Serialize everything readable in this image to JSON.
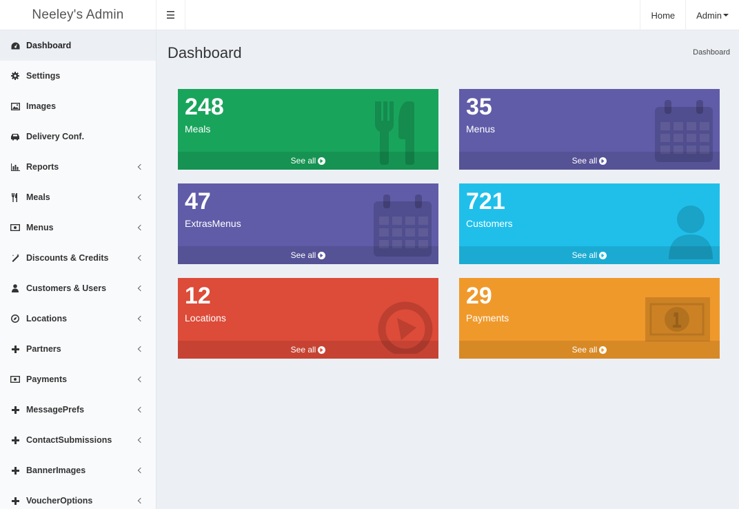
{
  "brand": "Neeley's Admin",
  "topnav": {
    "home": "Home",
    "admin": "Admin"
  },
  "sidebar": {
    "items": [
      {
        "label": "Dashboard",
        "icon": "dashboard-icon",
        "active": true
      },
      {
        "label": "Settings",
        "icon": "gear-icon"
      },
      {
        "label": "Images",
        "icon": "image-icon"
      },
      {
        "label": "Delivery Conf.",
        "icon": "car-icon"
      },
      {
        "label": "Reports",
        "icon": "bar-chart-icon"
      },
      {
        "label": "Meals",
        "icon": "cutlery-icon"
      },
      {
        "label": "Menus",
        "icon": "money-icon"
      },
      {
        "label": "Discounts & Credits",
        "icon": "magic-icon"
      },
      {
        "label": "Customers & Users",
        "icon": "user-icon"
      },
      {
        "label": "Locations",
        "icon": "compass-icon"
      },
      {
        "label": "Partners",
        "icon": "plus-icon"
      },
      {
        "label": "Payments",
        "icon": "money-icon"
      },
      {
        "label": "MessagePrefs",
        "icon": "plus-icon"
      },
      {
        "label": "ContactSubmissions",
        "icon": "plus-icon"
      },
      {
        "label": "BannerImages",
        "icon": "plus-icon"
      },
      {
        "label": "VoucherOptions",
        "icon": "plus-icon"
      }
    ]
  },
  "main": {
    "title": "Dashboard",
    "breadcrumb": "Dashboard",
    "footer_label": "See all",
    "cards": [
      {
        "value": "248",
        "label": "Meals",
        "color": "#19a45c",
        "icon": "cutlery-icon"
      },
      {
        "value": "35",
        "label": "Menus",
        "color": "#605ca8",
        "icon": "calendar-icon"
      },
      {
        "value": "47",
        "label": "ExtrasMenus",
        "color": "#605ca8",
        "icon": "calendar-icon"
      },
      {
        "value": "721",
        "label": "Customers",
        "color": "#1fbfea",
        "icon": "user-icon"
      },
      {
        "value": "12",
        "label": "Locations",
        "color": "#dd4b39",
        "icon": "play-circle-icon"
      },
      {
        "value": "29",
        "label": "Payments",
        "color": "#f0992b",
        "icon": "money-icon"
      }
    ]
  }
}
